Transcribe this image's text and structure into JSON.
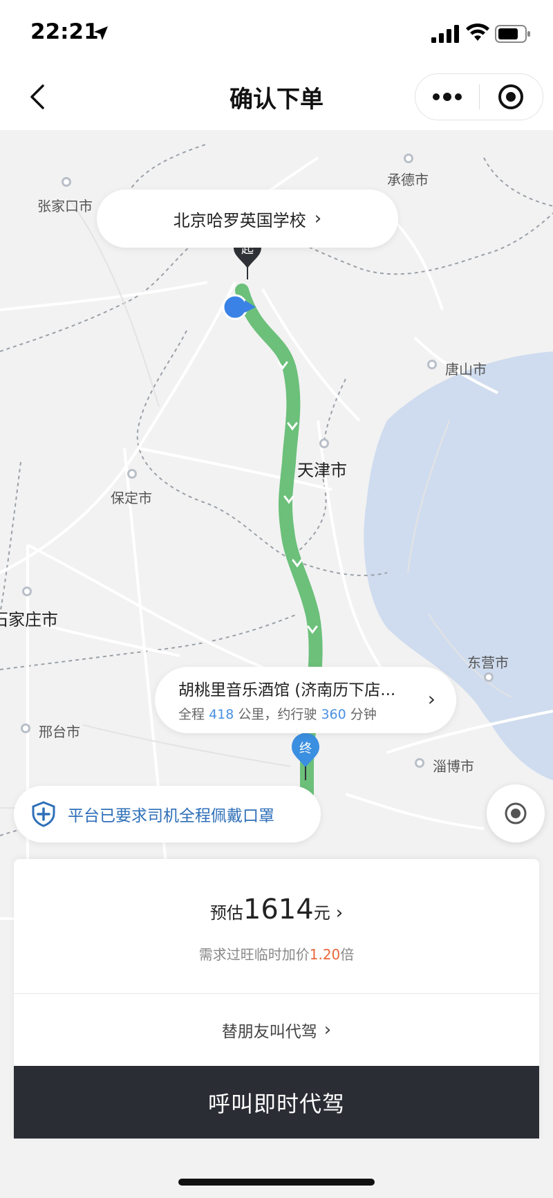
{
  "status_bar": {
    "time": "22:21"
  },
  "nav": {
    "title": "确认下单"
  },
  "map": {
    "cities": {
      "zhangjiakou": "张家口市",
      "chengde": "承德市",
      "tangshan": "唐山市",
      "tianjin": "天津市",
      "baoding": "保定市",
      "shijiazhuang": "石家庄市",
      "dongying": "东营市",
      "xingtai": "邢台市",
      "zibo": "淄博市"
    },
    "start_label": "北京哈罗英国学校",
    "start_marker": "起",
    "end_marker": "终",
    "destination": {
      "name": "胡桃里音乐酒馆 (济南历下店...",
      "prefix": "全程",
      "distance": "418",
      "distance_unit": "公里，约行驶",
      "duration": "360",
      "duration_unit": "分钟"
    },
    "route_color": "#6cc07a"
  },
  "notice": {
    "text": "平台已要求司机全程佩戴口罩"
  },
  "order": {
    "price_prefix": "预估",
    "price": "1614",
    "price_unit": "元",
    "surge_prefix": "需求过旺临时加价",
    "surge_multiplier": "1.20",
    "surge_suffix": "倍",
    "friend_label": "替朋友叫代驾",
    "call_button": "呼叫即时代驾"
  },
  "colors": {
    "accent_blue": "#2e6fb8",
    "surge_orange": "#e8663a",
    "button_dark": "#2b2d35"
  }
}
